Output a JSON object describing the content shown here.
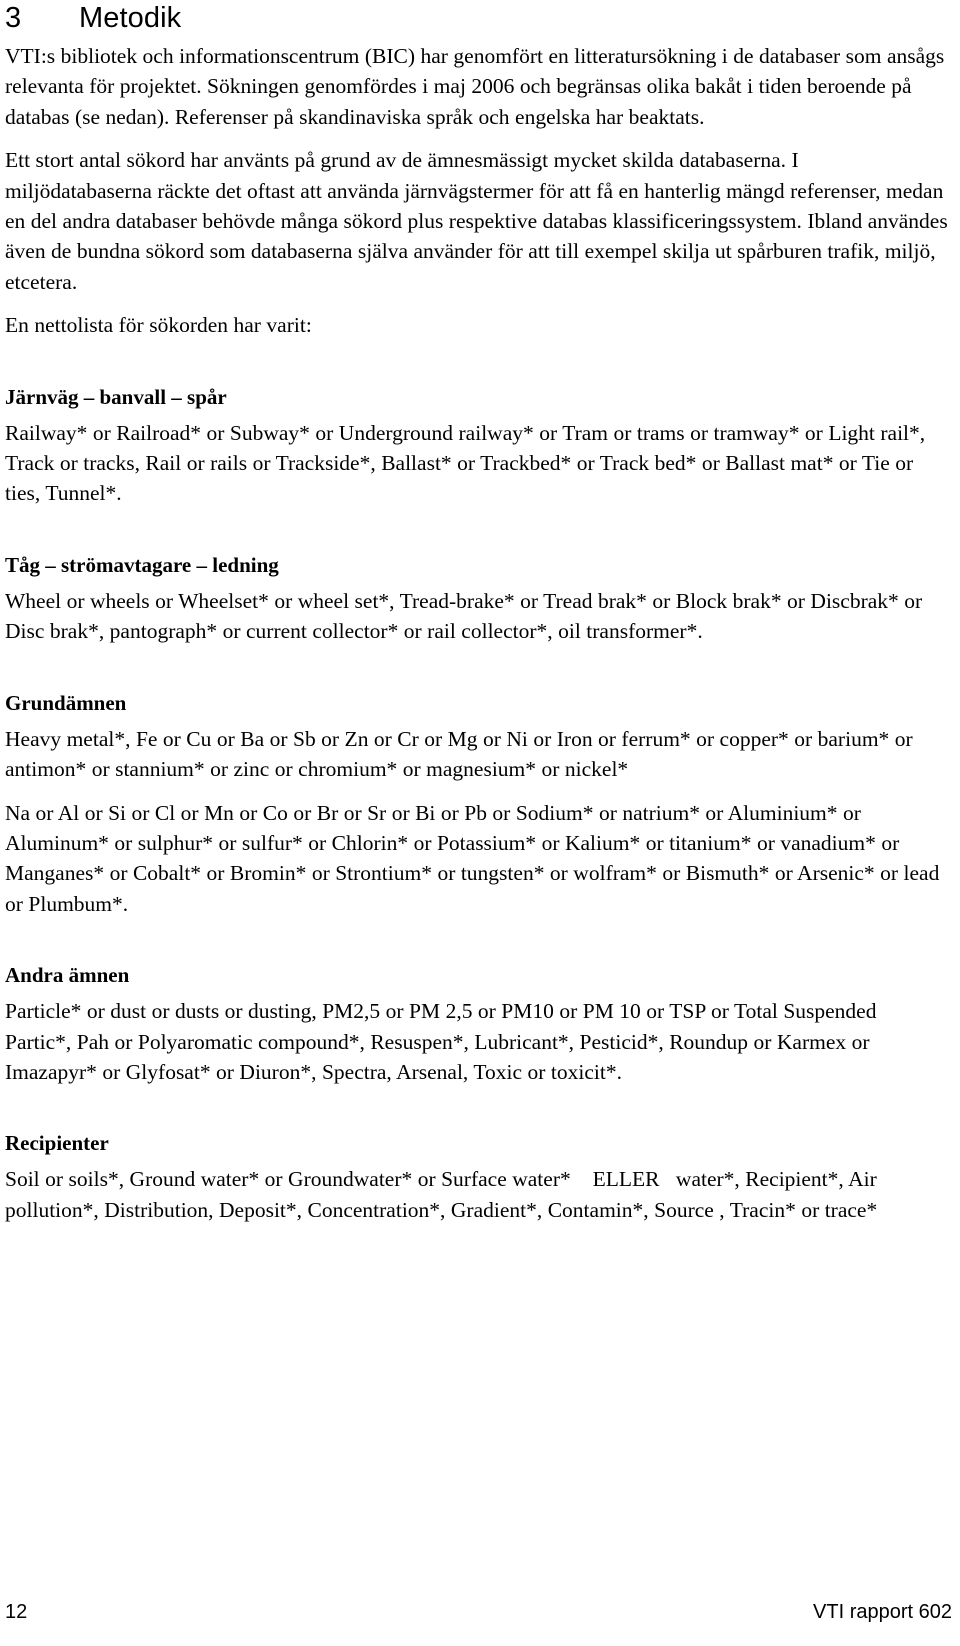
{
  "document": {
    "chapter": {
      "number": "3",
      "title": "Metodik"
    },
    "paragraphs": [
      "VTI:s bibliotek och informationscentrum (BIC) har genomfört en litteratursökning i de databaser som ansågs relevanta för projektet. Sökningen genomfördes i maj 2006 och begränsas olika bakåt i tiden beroende på databas (se nedan). Referenser på skandinaviska språk och engelska har beaktats.",
      "Ett stort antal sökord har använts på grund av de ämnesmässigt mycket skilda databaserna. I miljödatabaserna räckte det oftast att använda järnvägstermer för att få en hanterlig mängd referenser, medan en del andra databaser behövde många sökord plus respektive databas klassificeringssystem. Ibland användes även de bundna sökord som databaserna själva använder för att till exempel skilja ut spårburen trafik, miljö, etcetera.",
      "En nettolista för sökorden har varit:"
    ],
    "sections": [
      {
        "heading": "Järnväg – banvall – spår",
        "body": [
          "Railway* or Railroad* or Subway* or Underground railway* or Tram or trams or tramway* or Light rail*, Track or tracks, Rail or rails or Trackside*, Ballast* or Trackbed* or Track bed* or Ballast mat* or Tie or ties, Tunnel*."
        ]
      },
      {
        "heading": "Tåg – strömavtagare – ledning",
        "body": [
          "Wheel or wheels or Wheelset* or wheel set*, Tread-brake* or Tread brak* or Block brak* or Discbrak* or Disc brak*, pantograph* or current collector* or rail collector*, oil transformer*."
        ]
      },
      {
        "heading": "Grundämnen",
        "body": [
          "Heavy metal*, Fe or Cu or Ba or Sb or Zn or Cr or Mg or Ni or Iron or ferrum* or copper* or barium* or antimon* or stannium* or zinc or chromium* or magnesium* or nickel*",
          "Na or Al or Si or Cl or Mn or Co or Br or Sr or Bi or Pb or Sodium* or natrium* or Aluminium* or Aluminum* or sulphur* or sulfur* or Chlorin* or Potassium* or Kalium* or titanium* or vanadium* or Manganes* or Cobalt* or Bromin* or Strontium* or tungsten* or wolfram* or Bismuth* or Arsenic* or lead or Plumbum*."
        ]
      },
      {
        "heading": "Andra ämnen",
        "body": [
          "Particle* or dust or dusts or dusting, PM2,5 or PM 2,5 or PM10 or PM 10 or TSP or Total Suspended Partic*, Pah or Polyaromatic compound*, Resuspen*, Lubricant*, Pesticid*, Roundup or Karmex or Imazapyr* or Glyfosat* or Diuron*, Spectra, Arsenal, Toxic or toxicit*."
        ]
      },
      {
        "heading": "Recipienter",
        "body": [
          "Soil or soils*, Ground water* or Groundwater* or Surface water*    ELLER   water*, Recipient*, Air pollution*, Distribution, Deposit*, Concentration*, Gradient*, Contamin*, Source , Tracin* or trace*"
        ]
      }
    ],
    "footer": {
      "page_number": "12",
      "report_reference": "VTI rapport 602"
    }
  }
}
